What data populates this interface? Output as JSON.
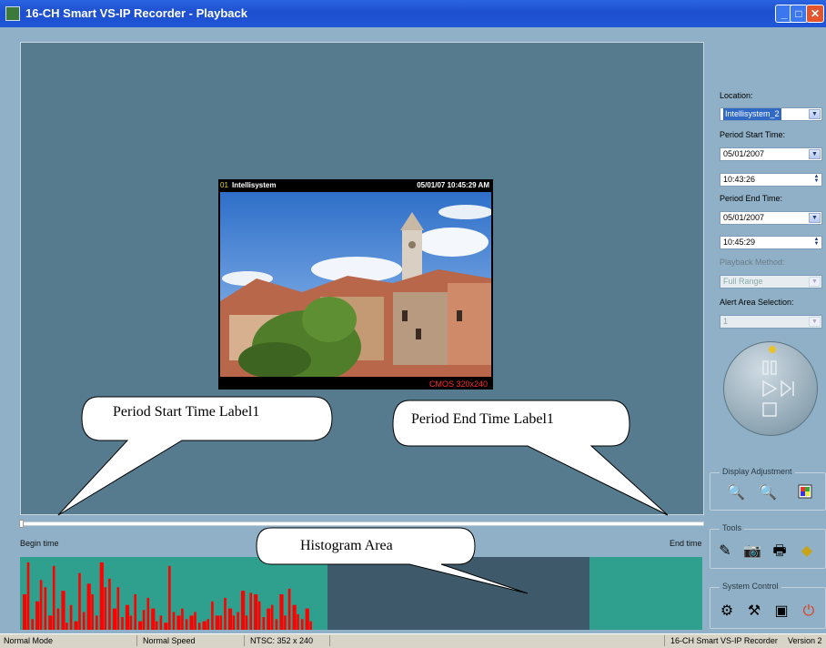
{
  "window": {
    "title": "16-CH Smart VS-IP Recorder - Playback",
    "app_icon": "app-icon",
    "buttons": [
      "minimize-icon",
      "maximize-icon",
      "close-icon"
    ]
  },
  "video": {
    "channel": "01",
    "camera_name": "Intellisystem",
    "timestamp": "05/01/07 10:45:29 AM",
    "resolution": "CMOS 320x240"
  },
  "callouts": {
    "start_label": "Period Start Time Label1",
    "end_label": "Period End Time Label1",
    "histogram_label": "Histogram Area"
  },
  "timeline": {
    "begin_label": "Begin time",
    "end_label": "End time"
  },
  "sidebar": {
    "location_label": "Location:",
    "location_value": "Intellisystem_2",
    "start_label": "Period Start Time:",
    "start_date": "05/01/2007",
    "start_time": "10:43:26",
    "end_label": "Period End Time:",
    "end_date": "05/01/2007",
    "end_time": "10:45:29",
    "playback_label": "Playback Method:",
    "playback_value": "Full Range",
    "alert_label": "Alert Area Selection:",
    "alert_value": "1"
  },
  "groups": {
    "display": "Display Adjustment",
    "tools": "Tools",
    "system": "System Control"
  },
  "status": {
    "mode": "Normal Mode",
    "speed": "Normal Speed",
    "video": "NTSC: 352 x 240",
    "product": "16-CH Smart VS-IP Recorder",
    "version": "Version 2"
  },
  "histogram": {
    "values": [
      0.5,
      0.95,
      0.15,
      0.4,
      0.7,
      0.6,
      0.2,
      0.9,
      0.3,
      0.55,
      0.1,
      0.35,
      0.12,
      0.8,
      0.25,
      0.65,
      0.5,
      0.2,
      0.95,
      0.6,
      0.72,
      0.3,
      0.6,
      0.18,
      0.35,
      0.2,
      0.5,
      0.12,
      0.28,
      0.45,
      0.3,
      0.12,
      0.2,
      0.1,
      0.9,
      0.25,
      0.2,
      0.3,
      0.15,
      0.2,
      0.25,
      0.1,
      0.12,
      0.15,
      0.4,
      0.2,
      0.2,
      0.45,
      0.3,
      0.2,
      0.25,
      0.55,
      0.2,
      0.52,
      0.5,
      0.4,
      0.18,
      0.3,
      0.35,
      0.15,
      0.5,
      0.2,
      0.58,
      0.35,
      0.22,
      0.15,
      0.3,
      0.12
    ],
    "bar_color": "#ff0000",
    "bg_color": "#2fa08d"
  }
}
